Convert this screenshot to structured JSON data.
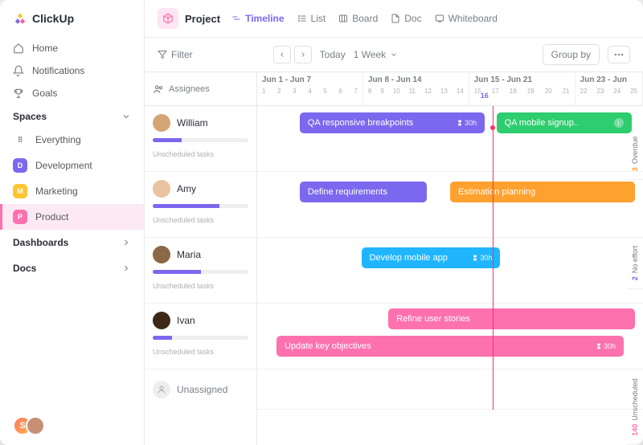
{
  "brand": "ClickUp",
  "nav": {
    "home": "Home",
    "notifications": "Notifications",
    "goals": "Goals"
  },
  "spaces": {
    "header": "Spaces",
    "items": [
      {
        "label": "Everything",
        "badge": "⠿",
        "color": "transparent"
      },
      {
        "label": "Development",
        "badge": "D",
        "color": "#7b68ee"
      },
      {
        "label": "Marketing",
        "badge": "M",
        "color": "#ffc530"
      },
      {
        "label": "Product",
        "badge": "P",
        "color": "#fd71af"
      }
    ]
  },
  "sections": {
    "dashboards": "Dashboards",
    "docs": "Docs"
  },
  "avatars": {
    "letter": "S"
  },
  "project": {
    "label": "Project",
    "tabs": [
      "Timeline",
      "List",
      "Board",
      "Doc",
      "Whiteboard"
    ]
  },
  "filter": {
    "label": "Filter",
    "today": "Today",
    "range": "1 Week",
    "group_by": "Group by"
  },
  "assignees_header": "Assignees",
  "weeks": [
    {
      "label": "Jun 1 - Jun 7",
      "days": [
        "1",
        "2",
        "3",
        "4",
        "5",
        "6",
        "7"
      ]
    },
    {
      "label": "Jun 8 - Jun 14",
      "days": [
        "8",
        "9",
        "10",
        "11",
        "12",
        "13",
        "14"
      ]
    },
    {
      "label": "Jun 15 - Jun 21",
      "days": [
        "15",
        "16",
        "17",
        "18",
        "19",
        "20",
        "21"
      ]
    },
    {
      "label": "Jun 23 - Jun",
      "days": [
        "22",
        "23",
        "24",
        "25"
      ]
    }
  ],
  "today_day": "16",
  "rows": [
    {
      "name": "William",
      "progress": 30,
      "unscheduled": "Unscheduled tasks"
    },
    {
      "name": "Amy",
      "progress": 70,
      "unscheduled": "Unscheduled tasks"
    },
    {
      "name": "Maria",
      "progress": 50,
      "unscheduled": "Unscheduled tasks"
    },
    {
      "name": "Ivan",
      "progress": 20,
      "unscheduled": "Unscheduled tasks"
    }
  ],
  "unassigned": "Unassigned",
  "tasks": {
    "qa_resp": {
      "label": "QA responsive breakpoints",
      "time": "30h"
    },
    "qa_mobile": {
      "label": "QA mobile signup.."
    },
    "define_req": {
      "label": "Define requirements"
    },
    "est_plan": {
      "label": "Estimation planning"
    },
    "dev_mobile": {
      "label": "Develop mobile app",
      "time": "30h"
    },
    "refine": {
      "label": "Refine user stories"
    },
    "update_obj": {
      "label": "Update key objectives",
      "time": "30h"
    }
  },
  "side": {
    "overdue": {
      "num": "3",
      "label": "Overdue"
    },
    "noeffort": {
      "num": "2",
      "label": "No effort"
    },
    "unsched": {
      "num": "140",
      "label": "Unscheduled"
    }
  },
  "colors": {
    "purple": "#7b68ee",
    "green": "#2ecd6f",
    "orange": "#ffa12f",
    "cyan": "#1fb6ff",
    "pink": "#fd71af"
  }
}
